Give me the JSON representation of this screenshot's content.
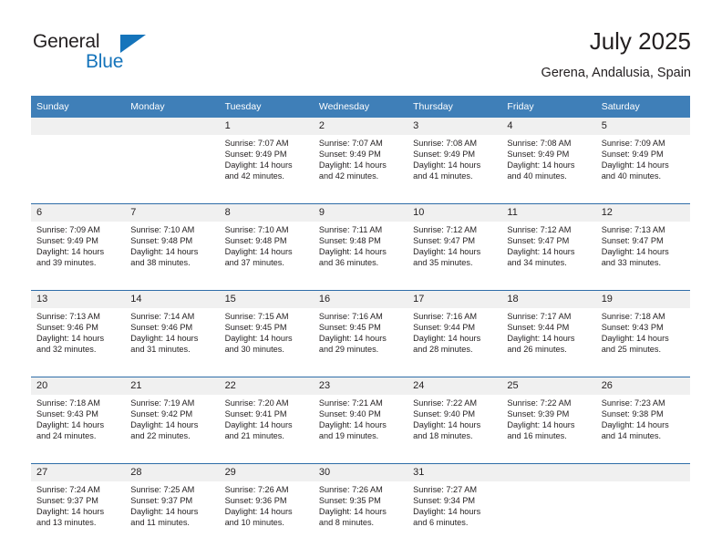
{
  "brand": {
    "name_part1": "General",
    "name_part2": "Blue"
  },
  "header": {
    "title": "July 2025",
    "subtitle": "Gerena, Andalusia, Spain"
  },
  "colors": {
    "header_blue": "#3f7fb8",
    "separator_blue": "#2f6da8",
    "daynum_band": "#f0f0f0",
    "brand_blue": "#1574bb",
    "text": "#231f20"
  },
  "weekdays": [
    "Sunday",
    "Monday",
    "Tuesday",
    "Wednesday",
    "Thursday",
    "Friday",
    "Saturday"
  ],
  "weeks": [
    {
      "days": [
        {
          "num": "",
          "lines": []
        },
        {
          "num": "",
          "lines": []
        },
        {
          "num": "1",
          "lines": [
            "Sunrise: 7:07 AM",
            "Sunset: 9:49 PM",
            "Daylight: 14 hours",
            "and 42 minutes."
          ]
        },
        {
          "num": "2",
          "lines": [
            "Sunrise: 7:07 AM",
            "Sunset: 9:49 PM",
            "Daylight: 14 hours",
            "and 42 minutes."
          ]
        },
        {
          "num": "3",
          "lines": [
            "Sunrise: 7:08 AM",
            "Sunset: 9:49 PM",
            "Daylight: 14 hours",
            "and 41 minutes."
          ]
        },
        {
          "num": "4",
          "lines": [
            "Sunrise: 7:08 AM",
            "Sunset: 9:49 PM",
            "Daylight: 14 hours",
            "and 40 minutes."
          ]
        },
        {
          "num": "5",
          "lines": [
            "Sunrise: 7:09 AM",
            "Sunset: 9:49 PM",
            "Daylight: 14 hours",
            "and 40 minutes."
          ]
        }
      ]
    },
    {
      "days": [
        {
          "num": "6",
          "lines": [
            "Sunrise: 7:09 AM",
            "Sunset: 9:49 PM",
            "Daylight: 14 hours",
            "and 39 minutes."
          ]
        },
        {
          "num": "7",
          "lines": [
            "Sunrise: 7:10 AM",
            "Sunset: 9:48 PM",
            "Daylight: 14 hours",
            "and 38 minutes."
          ]
        },
        {
          "num": "8",
          "lines": [
            "Sunrise: 7:10 AM",
            "Sunset: 9:48 PM",
            "Daylight: 14 hours",
            "and 37 minutes."
          ]
        },
        {
          "num": "9",
          "lines": [
            "Sunrise: 7:11 AM",
            "Sunset: 9:48 PM",
            "Daylight: 14 hours",
            "and 36 minutes."
          ]
        },
        {
          "num": "10",
          "lines": [
            "Sunrise: 7:12 AM",
            "Sunset: 9:47 PM",
            "Daylight: 14 hours",
            "and 35 minutes."
          ]
        },
        {
          "num": "11",
          "lines": [
            "Sunrise: 7:12 AM",
            "Sunset: 9:47 PM",
            "Daylight: 14 hours",
            "and 34 minutes."
          ]
        },
        {
          "num": "12",
          "lines": [
            "Sunrise: 7:13 AM",
            "Sunset: 9:47 PM",
            "Daylight: 14 hours",
            "and 33 minutes."
          ]
        }
      ]
    },
    {
      "days": [
        {
          "num": "13",
          "lines": [
            "Sunrise: 7:13 AM",
            "Sunset: 9:46 PM",
            "Daylight: 14 hours",
            "and 32 minutes."
          ]
        },
        {
          "num": "14",
          "lines": [
            "Sunrise: 7:14 AM",
            "Sunset: 9:46 PM",
            "Daylight: 14 hours",
            "and 31 minutes."
          ]
        },
        {
          "num": "15",
          "lines": [
            "Sunrise: 7:15 AM",
            "Sunset: 9:45 PM",
            "Daylight: 14 hours",
            "and 30 minutes."
          ]
        },
        {
          "num": "16",
          "lines": [
            "Sunrise: 7:16 AM",
            "Sunset: 9:45 PM",
            "Daylight: 14 hours",
            "and 29 minutes."
          ]
        },
        {
          "num": "17",
          "lines": [
            "Sunrise: 7:16 AM",
            "Sunset: 9:44 PM",
            "Daylight: 14 hours",
            "and 28 minutes."
          ]
        },
        {
          "num": "18",
          "lines": [
            "Sunrise: 7:17 AM",
            "Sunset: 9:44 PM",
            "Daylight: 14 hours",
            "and 26 minutes."
          ]
        },
        {
          "num": "19",
          "lines": [
            "Sunrise: 7:18 AM",
            "Sunset: 9:43 PM",
            "Daylight: 14 hours",
            "and 25 minutes."
          ]
        }
      ]
    },
    {
      "days": [
        {
          "num": "20",
          "lines": [
            "Sunrise: 7:18 AM",
            "Sunset: 9:43 PM",
            "Daylight: 14 hours",
            "and 24 minutes."
          ]
        },
        {
          "num": "21",
          "lines": [
            "Sunrise: 7:19 AM",
            "Sunset: 9:42 PM",
            "Daylight: 14 hours",
            "and 22 minutes."
          ]
        },
        {
          "num": "22",
          "lines": [
            "Sunrise: 7:20 AM",
            "Sunset: 9:41 PM",
            "Daylight: 14 hours",
            "and 21 minutes."
          ]
        },
        {
          "num": "23",
          "lines": [
            "Sunrise: 7:21 AM",
            "Sunset: 9:40 PM",
            "Daylight: 14 hours",
            "and 19 minutes."
          ]
        },
        {
          "num": "24",
          "lines": [
            "Sunrise: 7:22 AM",
            "Sunset: 9:40 PM",
            "Daylight: 14 hours",
            "and 18 minutes."
          ]
        },
        {
          "num": "25",
          "lines": [
            "Sunrise: 7:22 AM",
            "Sunset: 9:39 PM",
            "Daylight: 14 hours",
            "and 16 minutes."
          ]
        },
        {
          "num": "26",
          "lines": [
            "Sunrise: 7:23 AM",
            "Sunset: 9:38 PM",
            "Daylight: 14 hours",
            "and 14 minutes."
          ]
        }
      ]
    },
    {
      "days": [
        {
          "num": "27",
          "lines": [
            "Sunrise: 7:24 AM",
            "Sunset: 9:37 PM",
            "Daylight: 14 hours",
            "and 13 minutes."
          ]
        },
        {
          "num": "28",
          "lines": [
            "Sunrise: 7:25 AM",
            "Sunset: 9:37 PM",
            "Daylight: 14 hours",
            "and 11 minutes."
          ]
        },
        {
          "num": "29",
          "lines": [
            "Sunrise: 7:26 AM",
            "Sunset: 9:36 PM",
            "Daylight: 14 hours",
            "and 10 minutes."
          ]
        },
        {
          "num": "30",
          "lines": [
            "Sunrise: 7:26 AM",
            "Sunset: 9:35 PM",
            "Daylight: 14 hours",
            "and 8 minutes."
          ]
        },
        {
          "num": "31",
          "lines": [
            "Sunrise: 7:27 AM",
            "Sunset: 9:34 PM",
            "Daylight: 14 hours",
            "and 6 minutes."
          ]
        },
        {
          "num": "",
          "lines": []
        },
        {
          "num": "",
          "lines": []
        }
      ]
    }
  ]
}
